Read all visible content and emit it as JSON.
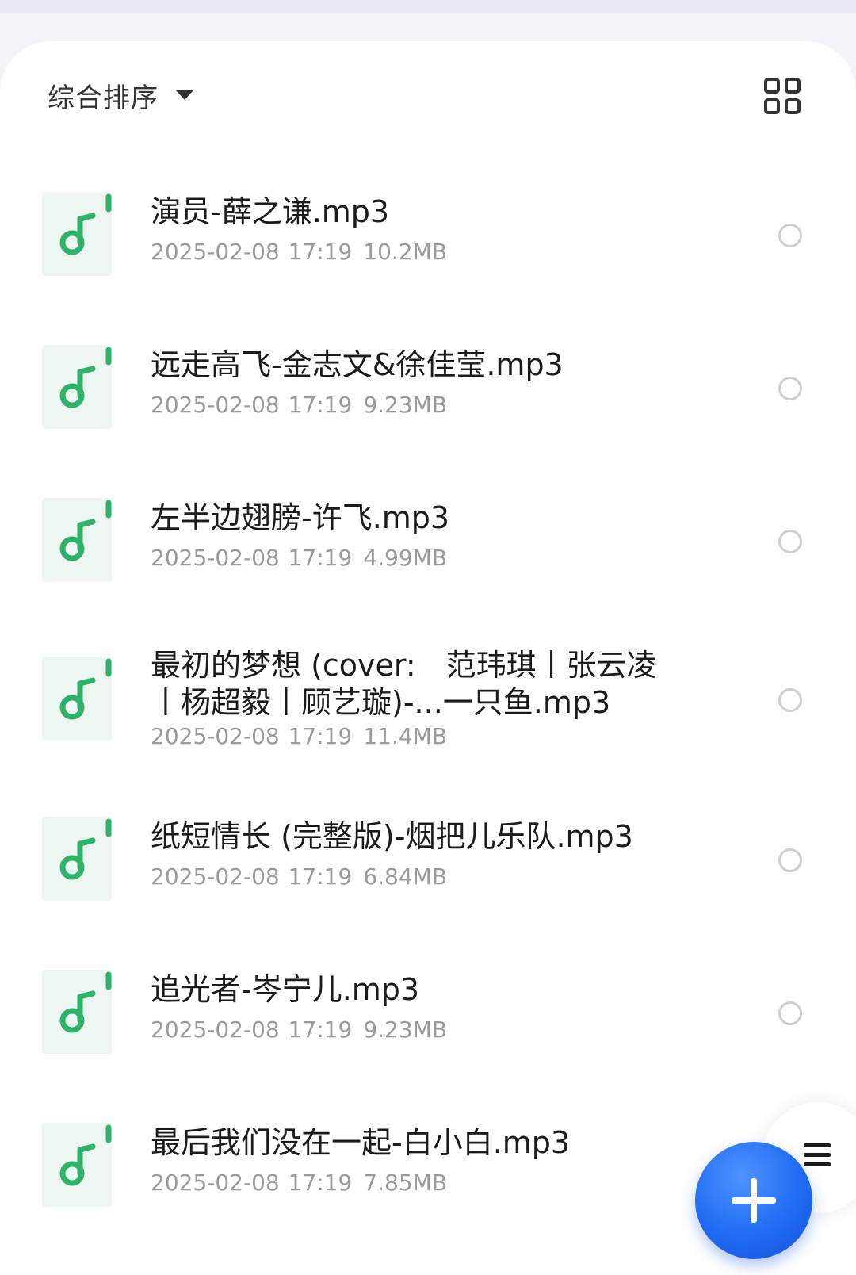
{
  "toolbar": {
    "sort_label": "综合排序"
  },
  "files": [
    {
      "name": "演员-薛之谦.mp3",
      "date": "2025-02-08 17:19",
      "size": "10.2MB"
    },
    {
      "name": "远走高飞-金志文&徐佳莹.mp3",
      "date": "2025-02-08 17:19",
      "size": "9.23MB"
    },
    {
      "name": "左半边翅膀-许飞.mp3",
      "date": "2025-02-08 17:19",
      "size": "4.99MB"
    },
    {
      "name": "最初的梦想 (cover:　范玮琪丨张云凌丨杨超毅丨顾艺璇)-...一只鱼.mp3",
      "date": "2025-02-08 17:19",
      "size": "11.4MB"
    },
    {
      "name": "纸短情长 (完整版)-烟把儿乐队.mp3",
      "date": "2025-02-08 17:19",
      "size": "6.84MB"
    },
    {
      "name": "追光者-岑宁儿.mp3",
      "date": "2025-02-08 17:19",
      "size": "9.23MB"
    },
    {
      "name": "最后我们没在一起-白小白.mp3",
      "date": "2025-02-08 17:19",
      "size": "7.85MB"
    }
  ],
  "icons": {
    "file_type": "music-file-icon",
    "view_toggle": "grid-view-icon",
    "fab": "plus-icon",
    "menu": "menu-icon"
  },
  "colors": {
    "accent_green": "#2fb36a",
    "fab_blue": "#1f6cf3"
  }
}
